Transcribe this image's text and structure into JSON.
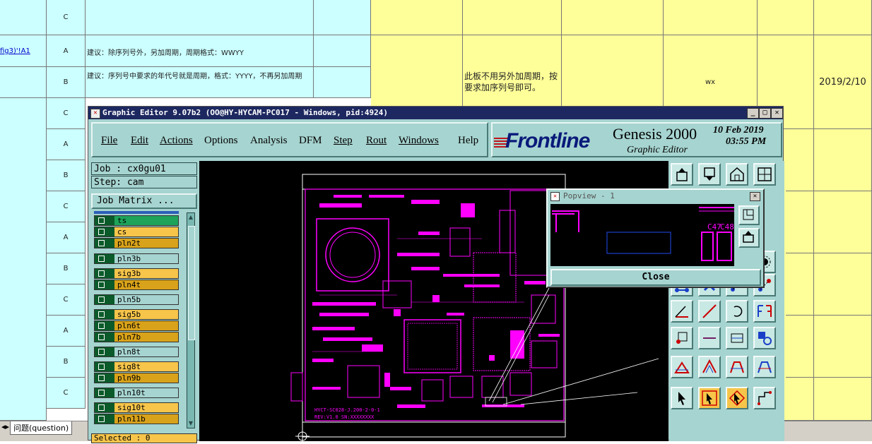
{
  "spreadsheet": {
    "ref_text": "fig3)'!A1",
    "rows": [
      {
        "choice": "C",
        "note": ""
      },
      {
        "choice": "A",
        "note": "建议：除序列号外，另加周期，周期格式：WWYY"
      },
      {
        "choice": "B",
        "note": "建议：序列号中要求的年代号就是周期，格式：YYYY，不再另加周期"
      },
      {
        "choice": "C",
        "note": ""
      },
      {
        "choice": "A",
        "note": ""
      },
      {
        "choice": "B",
        "note": ""
      },
      {
        "choice": "C",
        "note": ""
      },
      {
        "choice": "A",
        "note": ""
      },
      {
        "choice": "B",
        "note": ""
      },
      {
        "choice": "C",
        "note": ""
      },
      {
        "choice": "A",
        "note": ""
      },
      {
        "choice": "B",
        "note": ""
      },
      {
        "choice": "C",
        "note": ""
      }
    ],
    "reply": "此板不用另外加周期，按要求加序列号即可。",
    "author": "wx",
    "date": "2019/2/10",
    "sheet_tab": "问题(question)"
  },
  "window": {
    "title": "Graphic Editor 9.07b2 (OO@HY-HYCAM-PC017 - Windows, pid:4924)"
  },
  "menu": [
    "File",
    "Edit",
    "Actions",
    "Options",
    "Analysis",
    "DFM",
    "Step",
    "Rout",
    "Windows",
    "Help"
  ],
  "brand": {
    "logo": "Frontline",
    "product": "Genesis 2000",
    "subtitle": "Graphic Editor",
    "date": "10 Feb 2019",
    "time": "03:55 PM"
  },
  "job": {
    "job_label": "Job : cx0gu01",
    "step_label": "Step: cam",
    "matrix_button": "Job Matrix ..."
  },
  "layers": [
    {
      "name": "ts",
      "color": "green"
    },
    {
      "name": "cs",
      "color": "yellow"
    },
    {
      "name": "pln2t",
      "color": "orange"
    },
    {
      "name": "pln3b",
      "color": "teal"
    },
    {
      "name": "sig3b",
      "color": "yellow"
    },
    {
      "name": "pln4t",
      "color": "orange"
    },
    {
      "name": "pln5b",
      "color": "teal"
    },
    {
      "name": "sig5b",
      "color": "yellow"
    },
    {
      "name": "pln6t",
      "color": "orange"
    },
    {
      "name": "pln7b",
      "color": "orange"
    },
    {
      "name": "pln8t",
      "color": "teal"
    },
    {
      "name": "sig8t",
      "color": "yellow"
    },
    {
      "name": "pln9b",
      "color": "orange"
    },
    {
      "name": "pln10t",
      "color": "teal"
    },
    {
      "name": "sig10t",
      "color": "yellow"
    },
    {
      "name": "pln11b",
      "color": "orange"
    }
  ],
  "selected": "Selected : 0",
  "board": {
    "silk_line1": "HYCT-SC028-J.200-2-0-1",
    "silk_line2": "REV:V1.0 SN:XXXXXXXX"
  },
  "popview": {
    "title": "Popview - 1",
    "labels": [
      "C47",
      "C48"
    ],
    "close_button": "Close"
  },
  "colors": {
    "titlebar": "#1d2860",
    "panel": "#a6d4d0",
    "trace": "#ff00ff",
    "canvas": "#000000"
  }
}
